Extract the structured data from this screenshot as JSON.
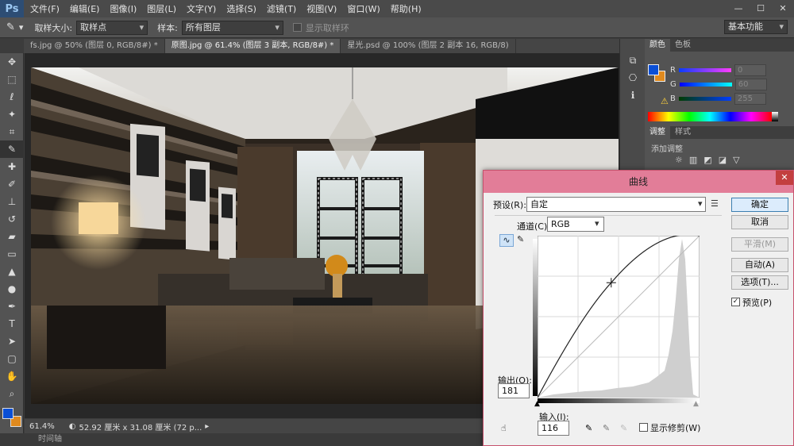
{
  "app": {
    "logo": "Ps"
  },
  "menu": [
    "文件(F)",
    "编辑(E)",
    "图像(I)",
    "图层(L)",
    "文字(Y)",
    "选择(S)",
    "滤镜(T)",
    "视图(V)",
    "窗口(W)",
    "帮助(H)"
  ],
  "window_controls": {
    "minimize": "—",
    "maximize": "☐",
    "close": "✕"
  },
  "options_bar": {
    "sample_size_label": "取样大小:",
    "sample_size_value": "取样点",
    "sample_label": "样本:",
    "sample_value": "所有图层",
    "show_ring_label": "显示取样环",
    "workspace": "基本功能"
  },
  "tabs": [
    {
      "label": "fs.jpg @ 50% (图层 0, RGB/8#) *",
      "active": false
    },
    {
      "label": "原图.jpg @ 61.4% (图层 3 副本, RGB/8#) *",
      "active": true
    },
    {
      "label": "星光.psd @ 100% (图层 2 副本 16, RGB/8)",
      "active": false
    }
  ],
  "tools": [
    "move-icon",
    "marquee-icon",
    "lasso-icon",
    "magic-wand-icon",
    "crop-icon",
    "eyedropper-icon",
    "healing-icon",
    "brush-icon",
    "stamp-icon",
    "history-brush-icon",
    "eraser-icon",
    "gradient-icon",
    "blur-icon",
    "dodge-icon",
    "pen-icon",
    "type-icon",
    "path-select-icon",
    "shape-icon",
    "hand-icon",
    "zoom-icon"
  ],
  "colors": {
    "foreground": "#0a4fd6",
    "background": "#e08a1e"
  },
  "status": {
    "zoom": "61.4%",
    "doc_info": "52.92 厘米 x 31.08 厘米 (72 p...",
    "timeline": "时间轴"
  },
  "right_panel": {
    "tab_color": "颜色",
    "tab_swatches": "色板",
    "r_label": "R",
    "r_value": "0",
    "g_label": "G",
    "g_value": "60",
    "b_label": "B",
    "b_value": "255",
    "tab_adjust": "调整",
    "tab_styles": "样式",
    "add_adjust": "添加调整"
  },
  "curves": {
    "title": "曲线",
    "preset_label": "预设(R):",
    "preset_value": "自定",
    "channel_label": "通道(C):",
    "channel_value": "RGB",
    "output_label": "输出(O):",
    "output_value": "181",
    "input_label": "输入(I):",
    "input_value": "116",
    "show_clipping": "显示修剪(W)",
    "buttons": {
      "ok": "确定",
      "cancel": "取消",
      "smooth": "平滑(M)",
      "auto": "自动(A)",
      "options": "选项(T)..."
    },
    "preview_label": "预览(P)",
    "preview_checked": true,
    "point": {
      "input": 116,
      "output": 181
    }
  }
}
